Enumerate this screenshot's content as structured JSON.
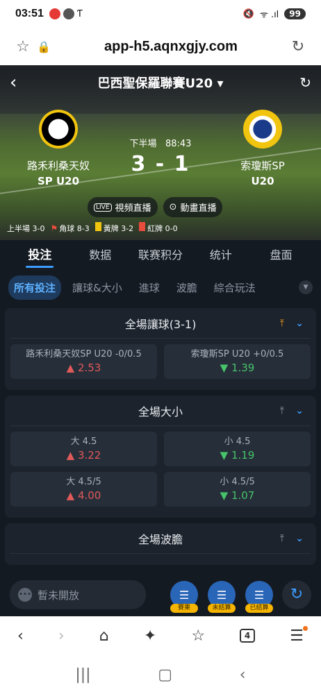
{
  "status_bar": {
    "time": "03:51",
    "battery": "99",
    "signal_text": "ᯤ .ıl"
  },
  "browser": {
    "url": "app-h5.aqnxgjy.com"
  },
  "match": {
    "league": "巴西聖保羅聯賽U20 ▾",
    "period": "下半場",
    "clock": "88:43",
    "score": "3 - 1",
    "home": {
      "name": "路禾利桑天奴",
      "sub": "SP U20"
    },
    "away": {
      "name": "索瓊斯SP",
      "sub": "U20"
    },
    "video_live": "視頻直播",
    "anim_live": "動畫直播",
    "live_badge": "LIVE",
    "stats": {
      "first_half": "上半場 3-0",
      "corners": "角球 8-3",
      "yellow": "黃牌 3-2",
      "red": "紅牌 0-0"
    }
  },
  "main_tabs": [
    "投注",
    "数据",
    "联赛积分",
    "统计",
    "盘面"
  ],
  "sub_tabs": [
    "所有投注",
    "讓球&大小",
    "進球",
    "波膽",
    "綜合玩法"
  ],
  "sections": [
    {
      "title": "全場讓球(3-1)",
      "pinned": true,
      "rows": [
        [
          {
            "label": "路禾利桑天奴SP U20 -0/0.5",
            "value": "2.53",
            "trend": "up"
          },
          {
            "label": "索瓊斯SP U20 +0/0.5",
            "value": "1.39",
            "trend": "down"
          }
        ]
      ]
    },
    {
      "title": "全場大小",
      "pinned": false,
      "rows": [
        [
          {
            "label": "大 4.5",
            "value": "3.22",
            "trend": "up"
          },
          {
            "label": "小 4.5",
            "value": "1.19",
            "trend": "down"
          }
        ],
        [
          {
            "label": "大 4.5/5",
            "value": "4.00",
            "trend": "up"
          },
          {
            "label": "小 4.5/5",
            "value": "1.07",
            "trend": "down"
          }
        ]
      ]
    },
    {
      "title": "全場波膽",
      "pinned": false,
      "rows": []
    }
  ],
  "bottom": {
    "closed_text": "暫未開放",
    "fab1": "賽果",
    "fab2": "未結算",
    "fab3": "已結算"
  },
  "colors": {
    "accent": "#3c9cff",
    "up": "#e05a5a",
    "down": "#47c46b",
    "panel": "#141a22"
  }
}
